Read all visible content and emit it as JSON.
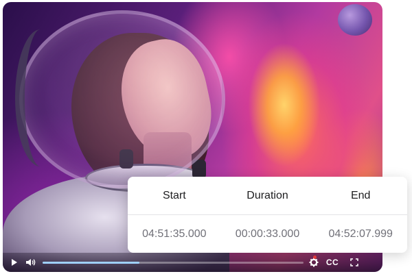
{
  "video": {
    "progress_fraction": 0.37
  },
  "segment_table": {
    "headers": {
      "start": "Start",
      "duration": "Duration",
      "end": "End"
    },
    "values": {
      "start": "04:51:35.000",
      "duration": "00:00:33.000",
      "end": "04:52:07.999"
    }
  },
  "controls": {
    "play_icon": "play-icon",
    "volume_icon": "volume-icon",
    "settings_icon": "gear-icon",
    "cc_label": "CC",
    "fullscreen_icon": "fullscreen-icon",
    "progress_color": "#9fd0ff"
  }
}
